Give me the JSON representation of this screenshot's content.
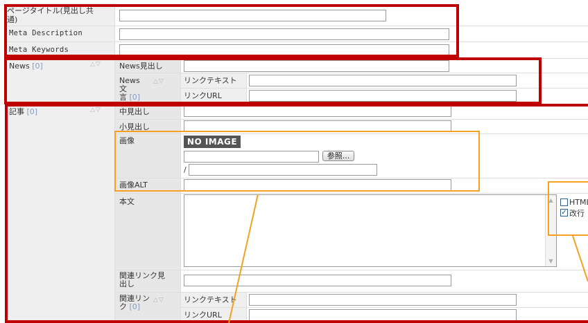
{
  "page_fields": {
    "page_title": {
      "label": "ページタイトル(見出し共通)",
      "value": ""
    },
    "meta_description": {
      "label": "Meta Description",
      "value": ""
    },
    "meta_keywords": {
      "label": "Meta Keywords",
      "value": ""
    }
  },
  "news": {
    "label": "News",
    "count": "[0]",
    "heading_label": "News見出し",
    "heading_value": "",
    "sentence_label_1": "News文",
    "sentence_label_2": "言",
    "sentence_count": "[0]",
    "link_text_label": "リンクテキスト",
    "link_text_value": "",
    "link_url_label": "リンクURL",
    "link_url_value": ""
  },
  "article": {
    "label": "記事",
    "count": "[0]",
    "mid_heading_label": "中見出し",
    "small_heading_label": "小見出し",
    "image_label": "画像",
    "no_image": "NO IMAGE",
    "browse_button": "参照...",
    "path_prefix": "/",
    "image_alt_label": "画像ALT",
    "body_label": "本文",
    "html_option": "HTML",
    "newline_option": "改行",
    "newline_checked": true,
    "related_heading_label_1": "関連リンク見",
    "related_heading_label_2": "出し",
    "related_link_label_1": "関連リン",
    "related_link_label_2": "ク",
    "related_link_count": "[0]",
    "related_text_label": "リンクテキスト",
    "related_url_label": "リンクURL"
  },
  "icons": {
    "move_up": "triangle-up-icon",
    "move_down": "shield-down-icon"
  },
  "annotation_colors": {
    "red": "#c00000",
    "orange": "#f5a020"
  }
}
